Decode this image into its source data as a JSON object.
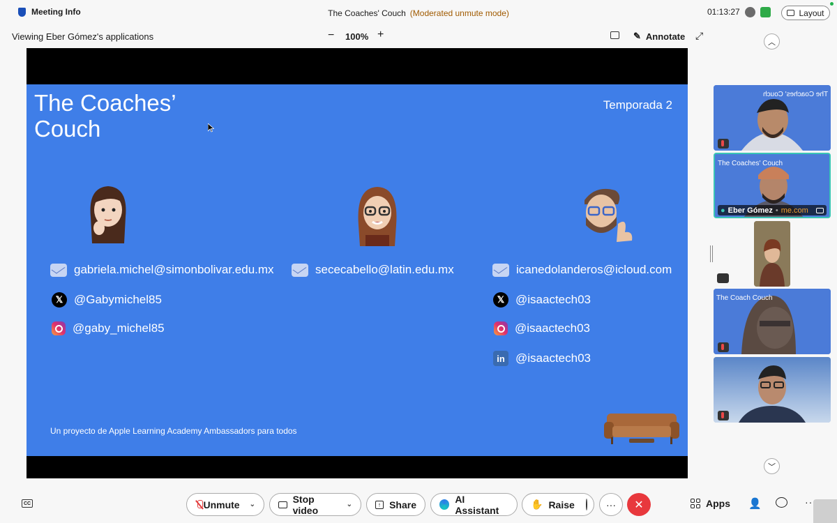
{
  "topbar": {
    "meeting_info": "Meeting Info",
    "meeting_title": "The Coaches' Couch",
    "mode": "(Moderated unmute mode)",
    "timer": "01:13:27",
    "layout_label": "Layout"
  },
  "viewing": {
    "text": "Viewing Eber Gómez's applications",
    "zoom": "100%",
    "minus": "−",
    "plus": "+",
    "annotate": "Annotate"
  },
  "slide": {
    "title": "The Coaches’ Couch",
    "season": "Temporada 2",
    "footer": "Un proyecto de Apple Learning Academy Ambassadors para todos",
    "columns": [
      {
        "email": "gabriela.michel@simonbolivar.edu.mx",
        "x": "@Gabymichel85",
        "instagram": "@gaby_michel85"
      },
      {
        "email": "sececabello@latin.edu.mx"
      },
      {
        "email": "icanedolanderos@icloud.com",
        "x": "@isaactech03",
        "instagram": "@isaactech03",
        "linkedin": "@isaactech03"
      }
    ]
  },
  "participants": {
    "tile1_label": "The Coaches' Couch",
    "tile2_label": "The Coaches' Couch",
    "tile2_name": "Eber Gómez",
    "tile2_link": "me.com",
    "tile4_label": "The Coach Couch"
  },
  "bottombar": {
    "unmute": "Unmute",
    "stop_video": "Stop video",
    "share": "Share",
    "ai_assistant": "AI Assistant",
    "raise": "Raise",
    "apps": "Apps",
    "more": "···"
  },
  "colors": {
    "slide_bg": "#3f7ee8",
    "leave": "#e8383d",
    "active_tile": "#3ac6b5"
  }
}
